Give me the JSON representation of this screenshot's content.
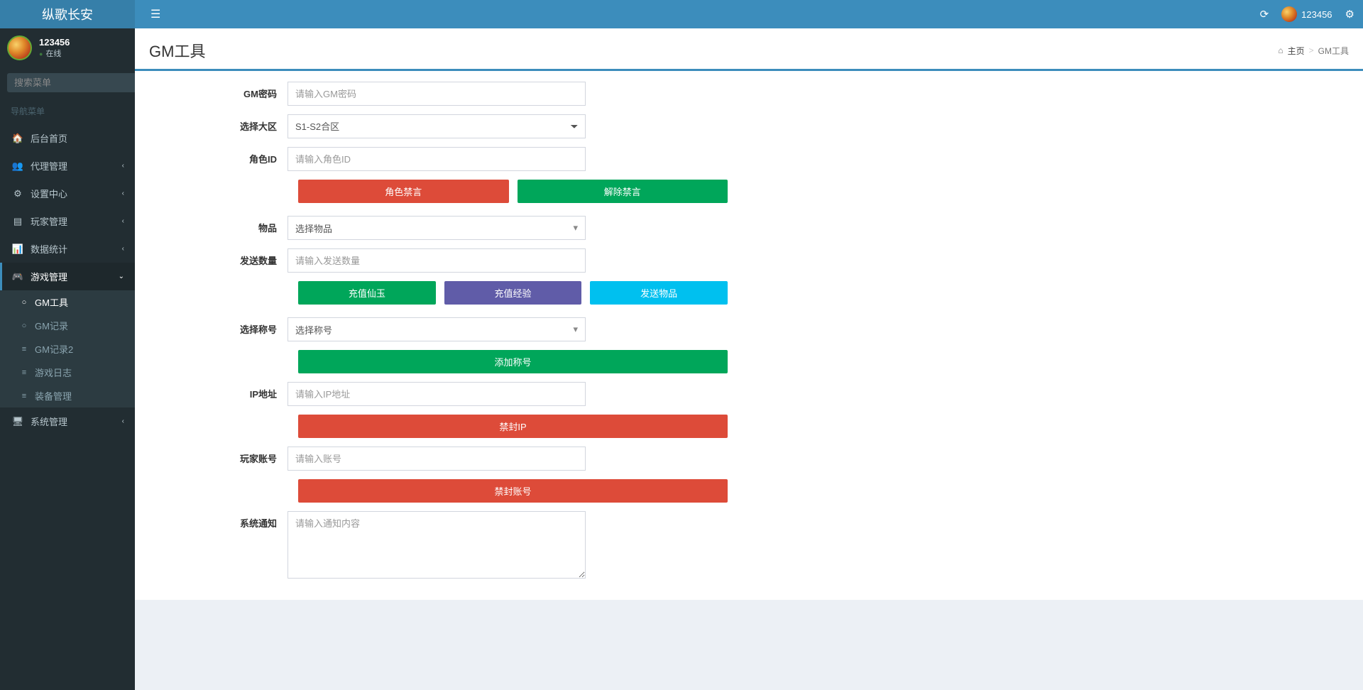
{
  "app": {
    "title": "纵歌长安"
  },
  "user": {
    "name": "123456",
    "status": "在线"
  },
  "sidebar": {
    "search_placeholder": "搜索菜单",
    "nav_header": "导航菜单",
    "items": [
      {
        "label": "后台首页"
      },
      {
        "label": "代理管理"
      },
      {
        "label": "设置中心"
      },
      {
        "label": "玩家管理"
      },
      {
        "label": "数据统计"
      },
      {
        "label": "游戏管理"
      },
      {
        "label": "系统管理"
      }
    ],
    "game_sub": [
      {
        "label": "GM工具"
      },
      {
        "label": "GM记录"
      },
      {
        "label": "GM记录2"
      },
      {
        "label": "游戏日志"
      },
      {
        "label": "装备管理"
      }
    ]
  },
  "topnav": {
    "username": "123456"
  },
  "page": {
    "title": "GM工具",
    "breadcrumb_home": "主页",
    "breadcrumb_current": "GM工具"
  },
  "form": {
    "gm_password_label": "GM密码",
    "gm_password_placeholder": "请输入GM密码",
    "zone_label": "选择大区",
    "zone_value": "S1-S2合区",
    "role_id_label": "角色ID",
    "role_id_placeholder": "请输入角色ID",
    "btn_ban_role": "角色禁言",
    "btn_unban_role": "解除禁言",
    "item_label": "物品",
    "item_placeholder": "选择物品",
    "send_qty_label": "发送数量",
    "send_qty_placeholder": "请输入发送数量",
    "btn_recharge_jade": "充值仙玉",
    "btn_recharge_exp": "充值经验",
    "btn_send_item": "发送物品",
    "title_label": "选择称号",
    "title_placeholder": "选择称号",
    "btn_add_title": "添加称号",
    "ip_label": "IP地址",
    "ip_placeholder": "请输入IP地址",
    "btn_ban_ip": "禁封IP",
    "account_label": "玩家账号",
    "account_placeholder": "请输入账号",
    "btn_ban_account": "禁封账号",
    "notice_label": "系统通知",
    "notice_placeholder": "请输入通知内容"
  }
}
